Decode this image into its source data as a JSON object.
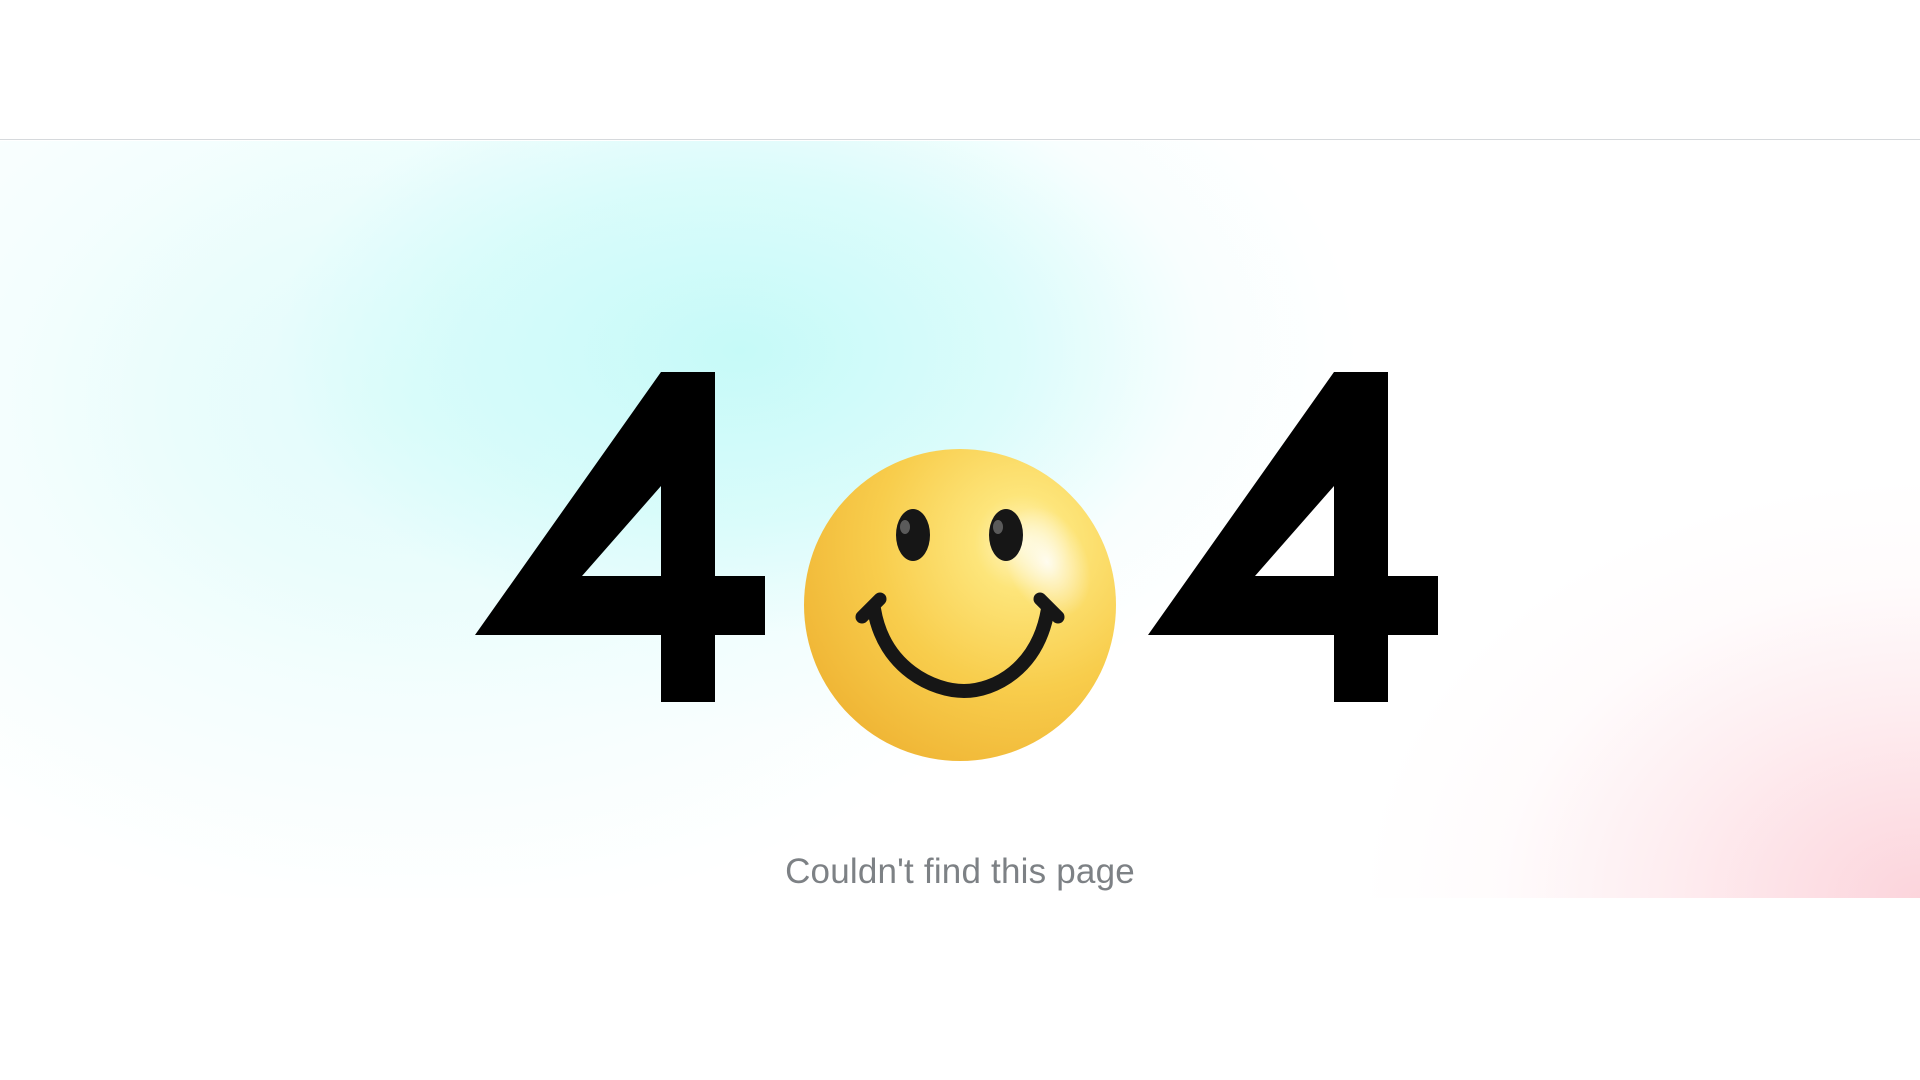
{
  "error": {
    "code_left": "4",
    "code_right": "4",
    "message": "Couldn't find this page"
  },
  "icons": {
    "center": "smiley-face-icon"
  },
  "colors": {
    "digit": "#000000",
    "message": "#7d8185",
    "smiley_yellow": "#f7c43f",
    "gradient_cyan": "#c4faf8",
    "gradient_pink": "#fcd2da"
  }
}
